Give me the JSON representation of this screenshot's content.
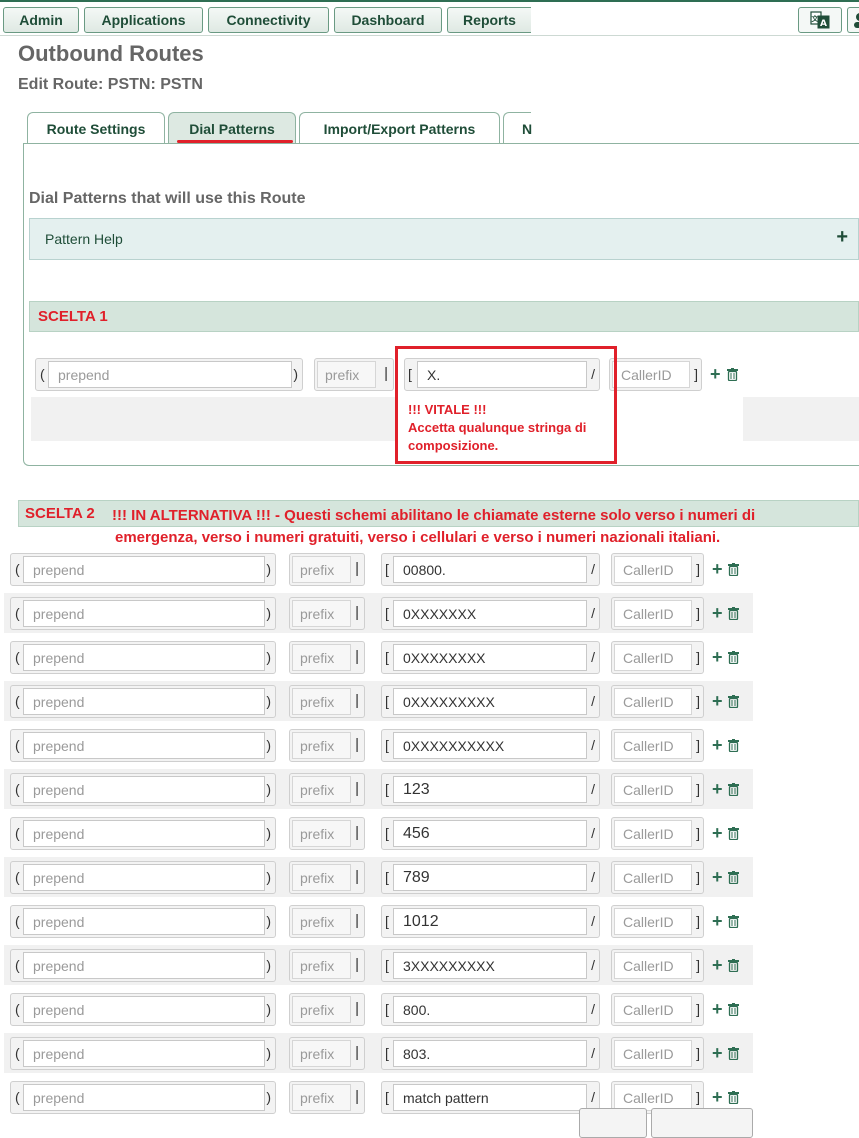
{
  "nav": {
    "items": [
      "Admin",
      "Applications",
      "Connectivity",
      "Dashboard",
      "Reports"
    ],
    "lang_icon": "translate-icon"
  },
  "page": {
    "title": "Outbound Routes",
    "subtitle": "Edit Route: PSTN: PSTN"
  },
  "tabs": [
    {
      "label": "Route Settings",
      "active": false
    },
    {
      "label": "Dial Patterns",
      "active": true
    },
    {
      "label": "Import/Export Patterns",
      "active": false
    },
    {
      "label": "N",
      "active": false
    }
  ],
  "section": {
    "title": "Dial Patterns that will use this Route",
    "help_label": "Pattern Help",
    "help_toggle": "+"
  },
  "scelta1": {
    "label": "SCELTA 1",
    "row": {
      "prepend": "prepend",
      "prefix": "prefix",
      "match": "X.",
      "callerid": "CallerID"
    },
    "note_line1": "!!! VITALE !!!",
    "note_line2": "Accetta qualunque stringa di",
    "note_line3": "composizione."
  },
  "scelta2": {
    "label": "SCELTA 2",
    "note_line1": "!!! IN ALTERNATIVA !!! - Questi schemi abilitano le chiamate esterne solo verso i numeri di",
    "note_line2": "emergenza, verso i numeri gratuiti, verso i cellulari e verso i numeri nazionali italiani.",
    "rows": [
      {
        "prepend": "prepend",
        "prefix": "prefix",
        "match": "00800.",
        "callerid": "CallerID"
      },
      {
        "prepend": "prepend",
        "prefix": "prefix",
        "match": "0XXXXXXX",
        "callerid": "CallerID"
      },
      {
        "prepend": "prepend",
        "prefix": "prefix",
        "match": "0XXXXXXXX",
        "callerid": "CallerID"
      },
      {
        "prepend": "prepend",
        "prefix": "prefix",
        "match": "0XXXXXXXXX",
        "callerid": "CallerID"
      },
      {
        "prepend": "prepend",
        "prefix": "prefix",
        "match": "0XXXXXXXXXX",
        "callerid": "CallerID"
      },
      {
        "prepend": "prepend",
        "prefix": "prefix",
        "match": "123",
        "callerid": "CallerID"
      },
      {
        "prepend": "prepend",
        "prefix": "prefix",
        "match": "456",
        "callerid": "CallerID"
      },
      {
        "prepend": "prepend",
        "prefix": "prefix",
        "match": "789",
        "callerid": "CallerID"
      },
      {
        "prepend": "prepend",
        "prefix": "prefix",
        "match": "1012",
        "callerid": "CallerID"
      },
      {
        "prepend": "prepend",
        "prefix": "prefix",
        "match": "3XXXXXXXXX",
        "callerid": "CallerID"
      },
      {
        "prepend": "prepend",
        "prefix": "prefix",
        "match": "800.",
        "callerid": "CallerID"
      },
      {
        "prepend": "prepend",
        "prefix": "prefix",
        "match": "803.",
        "callerid": "CallerID"
      },
      {
        "prepend": "prepend",
        "prefix": "prefix",
        "match": "match pattern",
        "callerid": "CallerID"
      }
    ]
  },
  "symbols": {
    "open_paren": "(",
    "close_paren": ")",
    "pipe": "|",
    "open_bracket": "[",
    "slash": "/",
    "close_bracket": "]",
    "add": "+"
  },
  "colors": {
    "accent": "#2e6e53",
    "annotation_red": "#e0202a",
    "section_bg": "#d5e5dc",
    "help_bg": "#e4f0ef"
  }
}
